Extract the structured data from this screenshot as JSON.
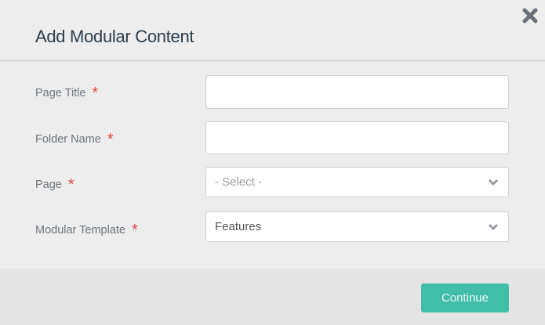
{
  "dialog": {
    "title": "Add Modular Content",
    "fields": [
      {
        "label": "Page Title",
        "required_mark": "*",
        "value": ""
      },
      {
        "label": "Folder Name",
        "required_mark": "*",
        "value": ""
      },
      {
        "label": "Page",
        "required_mark": "*",
        "value": "- Select -"
      },
      {
        "label": "Modular Template",
        "required_mark": "*",
        "value": "Features"
      }
    ],
    "continue_label": "Continue"
  },
  "colors": {
    "accent": "#41bea8",
    "required": "#e2493f"
  }
}
